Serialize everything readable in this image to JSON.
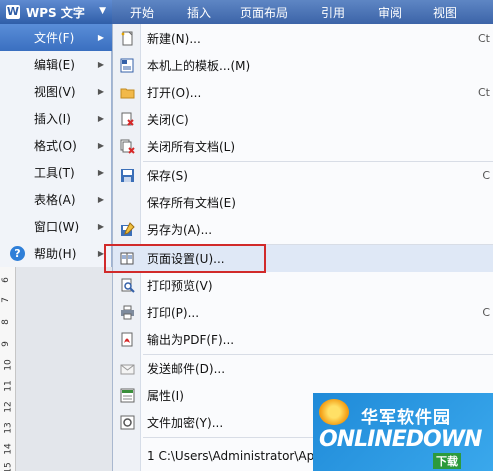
{
  "app": {
    "title": "WPS 文字",
    "logo_letter": "W",
    "caret": "▼"
  },
  "ribbon_tabs": [
    "开始",
    "插入",
    "页面布局",
    "引用",
    "审阅",
    "视图"
  ],
  "app_menu": [
    {
      "label": "文件(F)",
      "selected": true
    },
    {
      "label": "编辑(E)"
    },
    {
      "label": "视图(V)"
    },
    {
      "label": "插入(I)"
    },
    {
      "label": "格式(O)"
    },
    {
      "label": "工具(T)"
    },
    {
      "label": "表格(A)"
    },
    {
      "label": "窗口(W)"
    },
    {
      "label": "帮助(H)"
    }
  ],
  "submenu": [
    {
      "label": "新建(N)...",
      "shortcut": "Ct",
      "icon": "new-document-icon"
    },
    {
      "label": "本机上的模板...(M)",
      "shortcut": "",
      "icon": "template-icon"
    },
    {
      "label": "打开(O)...",
      "shortcut": "Ct",
      "icon": "open-folder-icon"
    },
    {
      "label": "关闭(C)",
      "shortcut": "",
      "icon": "close-document-icon"
    },
    {
      "label": "关闭所有文档(L)",
      "shortcut": "",
      "icon": "close-all-icon"
    },
    {
      "label": "保存(S)",
      "shortcut": "C",
      "icon": "save-icon"
    },
    {
      "label": "保存所有文档(E)",
      "shortcut": "",
      "icon": ""
    },
    {
      "label": "另存为(A)...",
      "shortcut": "",
      "icon": "save-as-icon"
    },
    {
      "label": "页面设置(U)...",
      "shortcut": "",
      "icon": "page-setup-icon"
    },
    {
      "label": "打印预览(V)",
      "shortcut": "",
      "icon": "print-preview-icon"
    },
    {
      "label": "打印(P)...",
      "shortcut": "C",
      "icon": "print-icon"
    },
    {
      "label": "输出为PDF(F)...",
      "shortcut": "",
      "icon": "pdf-icon"
    },
    {
      "label": "发送邮件(D)...",
      "shortcut": "",
      "icon": "mail-icon"
    },
    {
      "label": "属性(I)",
      "shortcut": "",
      "icon": "properties-icon"
    },
    {
      "label": "文件加密(Y)...",
      "shortcut": "",
      "icon": "encrypt-icon"
    },
    {
      "label": "1 C:\\Users\\Administrator\\App",
      "shortcut": "",
      "icon": ""
    }
  ],
  "ruler_numbers": [
    "6",
    "7",
    "8",
    "9",
    "10",
    "11",
    "12",
    "13",
    "14",
    "15"
  ],
  "watermark": {
    "brand": "华军软件园",
    "main": "ONLINEDOWN",
    "sub": "下载"
  },
  "colors": {
    "accent": "#3a6fc0",
    "highlight_border": "#d12a2a"
  }
}
